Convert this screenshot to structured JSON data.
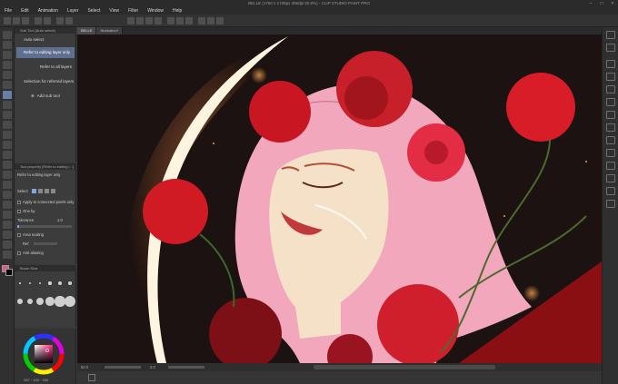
{
  "window": {
    "title": "BELLE (1760 x 1728px 350dpi 50.0%) - CLIP STUDIO PAINT PRO"
  },
  "menu": [
    "File",
    "Edit",
    "Animation",
    "Layer",
    "Select",
    "View",
    "Filter",
    "Window",
    "Help"
  ],
  "document_tabs": [
    {
      "label": "BELLE",
      "active": true
    },
    {
      "label": "Illustration*",
      "active": false
    }
  ],
  "sub_tool_panel": {
    "header": "Sub Tool [Auto select]",
    "items": [
      {
        "label": "Auto select",
        "active": false
      },
      {
        "label": "Refer to editing layer only",
        "active": true
      },
      {
        "label": "Refer to all layers",
        "active": false
      },
      {
        "label": "Selection for referred layers",
        "active": false
      }
    ],
    "add_label": "Add sub tool"
  },
  "tool_property_panel": {
    "header": "Tool property [Refer to editing l...]",
    "tool_name": "Refer to editing layer only",
    "select_label": "Select",
    "apply_connected": "Apply to connected pixels only",
    "one_by": "One by",
    "tolerance_label": "Tolerance",
    "tolerance_value": "1.0",
    "area_scaling": "Area scaling",
    "area_value": "Ref",
    "anti_aliasing": "Anti-aliasing"
  },
  "brush_size_panel": {
    "header": "Brush Size"
  },
  "color_panel": {
    "readout": "287 · 100 · 180",
    "main_color": "#e05a8a",
    "sub_color": "#000000"
  },
  "status_bar": {
    "zoom": "50.0",
    "angle": "0.0"
  },
  "colors": {
    "selected_item": "#5f6f8f",
    "panel_bg": "#3c3c3c",
    "canvas_bg": "#1b1211"
  }
}
